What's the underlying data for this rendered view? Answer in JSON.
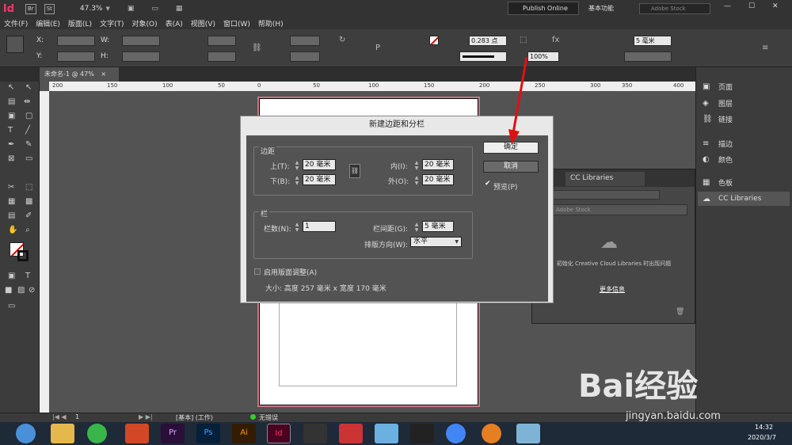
{
  "app": {
    "logo": "Id",
    "br": "Br",
    "st": "St",
    "zoom": "47.3%",
    "publish_online": "Publish Online",
    "workspace": "基本功能",
    "stock_search": "Adobe Stock"
  },
  "menu": [
    "文件(F)",
    "编辑(E)",
    "版面(L)",
    "文字(T)",
    "对象(O)",
    "表(A)",
    "视图(V)",
    "窗口(W)",
    "帮助(H)"
  ],
  "control": {
    "x_label": "X:",
    "y_label": "Y:",
    "w_label": "W:",
    "h_label": "H:",
    "stroke_weight": "0.283 点",
    "opacity": "100%",
    "gap": "5 毫米"
  },
  "document_tab": {
    "title": "未命名-1 @ 47%",
    "close": "×"
  },
  "ruler": {
    "marks": [
      "200",
      "150",
      "100",
      "50",
      "0",
      "50",
      "100",
      "150",
      "200",
      "250",
      "300",
      "350",
      "400"
    ]
  },
  "panels": {
    "items": [
      {
        "icon": "pages-icon",
        "label": "页面"
      },
      {
        "icon": "layers-icon",
        "label": "图层"
      },
      {
        "icon": "links-icon",
        "label": "链接"
      },
      {
        "icon": "stroke-icon",
        "label": "描边"
      },
      {
        "icon": "color-icon",
        "label": "颜色"
      },
      {
        "icon": "swatches-icon",
        "label": "色板"
      },
      {
        "icon": "cc-libraries-icon",
        "label": "CC Libraries"
      }
    ]
  },
  "cc_panel": {
    "tab": "CC Libraries",
    "search_placeholder": "Adobe Stock",
    "message": "初始化 Creative Cloud Libraries 时出现问题",
    "more_info": "更多信息"
  },
  "dialog": {
    "title": "新建边距和分栏",
    "ok": "确定",
    "cancel": "取消",
    "preview": "预览(P)",
    "margins": {
      "legend": "边距",
      "top_label": "上(T):",
      "top": "20 毫米",
      "bottom_label": "下(B):",
      "bottom": "20 毫米",
      "inside_label": "内(I):",
      "inside": "20 毫米",
      "outside_label": "外(O):",
      "outside": "20 毫米"
    },
    "columns": {
      "legend": "栏",
      "number_label": "栏数(N):",
      "number": "1",
      "gutter_label": "栏间距(G):",
      "gutter": "5 毫米",
      "direction_label": "排版方向(W):",
      "direction": "水平"
    },
    "adjust_label": "启用版面调整(A)",
    "size_text": "大小: 高度 257 毫米 x 宽度 170 毫米"
  },
  "status": {
    "page": "1",
    "style": "[基本] (工作)",
    "errors": "无错误"
  },
  "taskbar": {
    "time": "14:32",
    "date": "2020/3/7"
  },
  "watermark": {
    "brand": "Bai经验",
    "url": "jingyan.baidu.com"
  }
}
